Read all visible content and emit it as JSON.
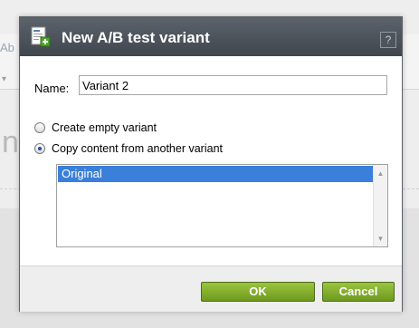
{
  "dialog": {
    "title": "New A/B test variant",
    "help_label": "?",
    "name_label": "Name:",
    "name_value": "Variant 2",
    "options": [
      {
        "label": "Create empty variant",
        "selected": false
      },
      {
        "label": "Copy content from another variant",
        "selected": true
      }
    ],
    "variants_list": [
      {
        "label": "Original",
        "selected": true
      }
    ],
    "buttons": {
      "ok_label": "OK",
      "cancel_label": "Cancel"
    }
  },
  "icons": {
    "title_icon": "document-add-icon",
    "scroll_up": "triangle-up-icon",
    "scroll_down": "triangle-down-icon"
  },
  "colors": {
    "titlebar": "#4a5058",
    "selection": "#3a7fd9",
    "button_green": "#80ab2c"
  }
}
